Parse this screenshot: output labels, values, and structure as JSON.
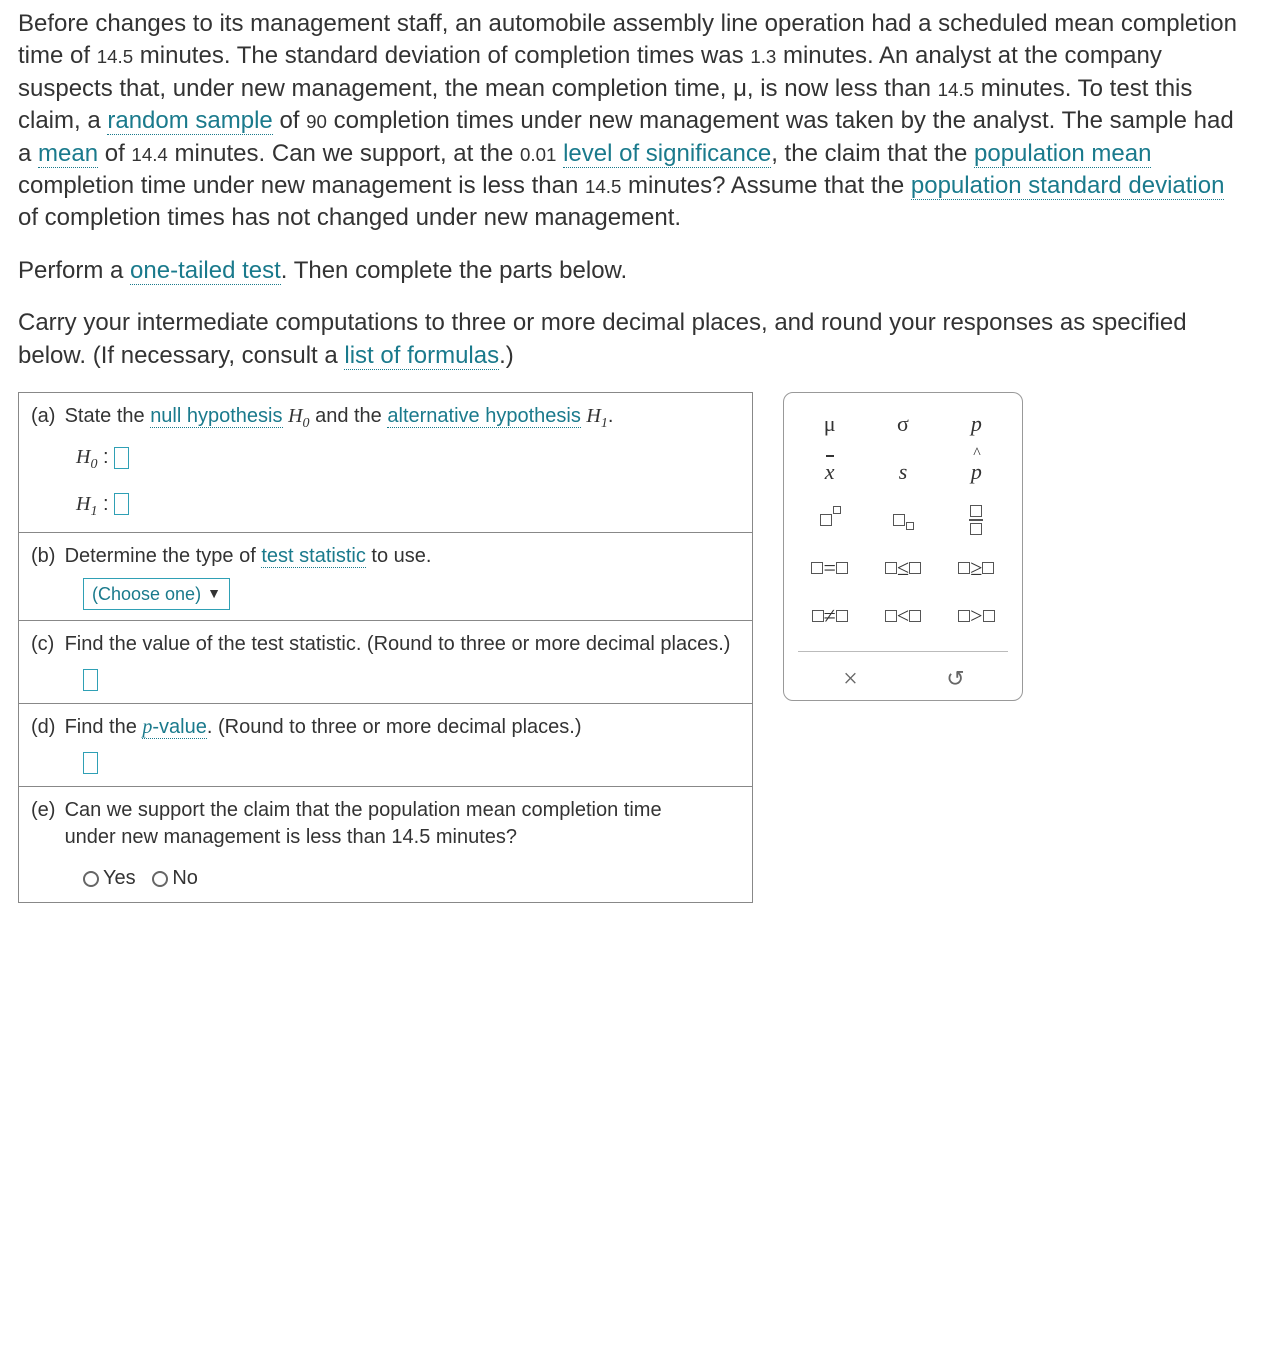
{
  "problem": {
    "p1_a": "Before changes to its management staff, an automobile assembly line operation had a scheduled mean completion time of ",
    "v1": "14.5",
    "p1_b": " minutes. The standard deviation of completion times was ",
    "v2": "1.3",
    "p1_c": " minutes. An analyst at the company suspects that, under new management, the mean completion time, ",
    "mu": "μ",
    "p1_d": ", is now less than ",
    "v3": "14.5",
    "p1_e": " minutes. To test this claim, a ",
    "link_random_sample": "random sample",
    "p1_f": " of ",
    "v4": "90",
    "p1_g": " completion times under new management was taken by the analyst. The sample had a ",
    "link_mean": "mean",
    "p1_h": " of ",
    "v5": "14.4",
    "p1_i": " minutes. Can we support, at the ",
    "v6": "0.01",
    "p1_j": " ",
    "link_los": "level of significance",
    "p1_k": ", the claim that the ",
    "link_pop_mean": "population mean",
    "p1_l": " completion time under new management is less than ",
    "v7": "14.5",
    "p1_m": " minutes? Assume that the ",
    "link_psd": "population standard deviation",
    "p1_n": " of completion times has not changed under new management."
  },
  "p2_a": "Perform a ",
  "p2_link": "one-tailed test",
  "p2_b": ". Then complete the parts below.",
  "p3_a": "Carry your intermediate computations to three or more decimal places, and round your responses as specified below. (If necessary, consult a ",
  "p3_link": "list of formulas",
  "p3_b": ".)",
  "parts": {
    "a_lbl": "(a)",
    "a_t1": "State the ",
    "a_link1": "null hypothesis",
    "a_t2": " and the ",
    "a_link2": "alternative hypothesis",
    "h0": "H",
    "h0sub": "0",
    "h1": "H",
    "h1sub": "1",
    "colon": " : ",
    "dot": ".",
    "b_lbl": "(b)",
    "b_text": "Determine the type of ",
    "b_link": "test statistic",
    "b_text2": " to use.",
    "choose": "(Choose one)",
    "c_lbl": "(c)",
    "c_text": "Find the value of the test statistic. (Round to three or more decimal places.)",
    "d_lbl": "(d)",
    "d_t1": "Find the ",
    "d_link": "p",
    "d_t2": "-value",
    "d_t3": ". (Round to three or more decimal places.)",
    "e_lbl": "(e)",
    "e_text": "Can we support the claim that the population mean completion time under new management is less than 14.5 minutes?",
    "yes": "Yes",
    "no": "No"
  },
  "palette": {
    "mu": "μ",
    "sigma": "σ",
    "p": "p",
    "xbar": "x",
    "s": "s",
    "phat": "p",
    "eq": "=",
    "le": "≤",
    "ge": "≥",
    "ne": "≠",
    "lt": "<",
    "gt": ">",
    "close": "×",
    "reset": "↺"
  }
}
